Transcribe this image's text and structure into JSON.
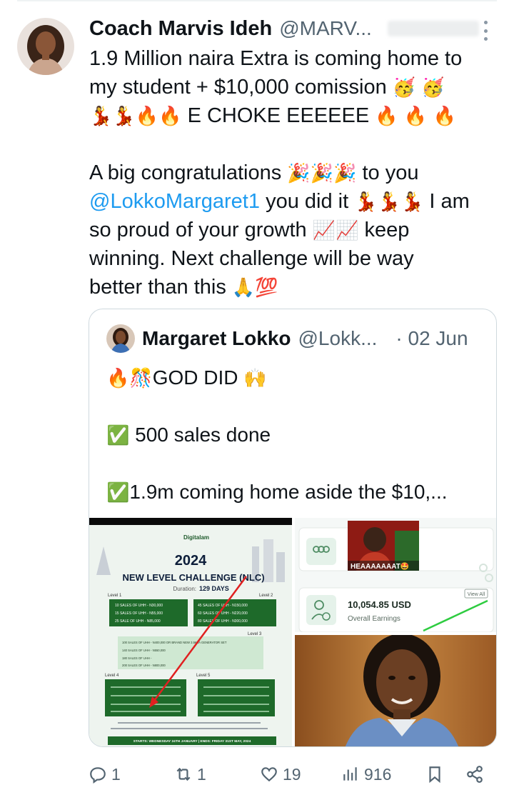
{
  "author": {
    "name": "Coach Marvis Ideh",
    "handle": "@MARV..."
  },
  "tweet": {
    "line1": "1.9 Million naira Extra is coming home to",
    "line2_text": "my student + $10,000 comission",
    "line2_emoji": "🥳 🥳",
    "line3_emoji_pre": "💃💃🔥🔥",
    "line3_text": "E CHOKE EEEEEE",
    "line3_emoji_post": "🔥 🔥 🔥",
    "line5_text": "A big congratulations",
    "line5_emoji": "🎉🎉🎉",
    "line5_text2": "to you",
    "mention": "@LokkoMargaret1",
    "line6_text": "you did it",
    "line6_emoji": "💃💃💃",
    "line6_text2": "I am",
    "line7_text": "so proud of your growth",
    "line7_emoji": "📈📈",
    "line7_text2": "keep",
    "line8": "winning. Next challenge will be way",
    "line9_text": "better than this",
    "line9_emoji": "🙏💯"
  },
  "quote": {
    "name": "Margaret Lokko",
    "handle": "@Lokk...",
    "date": "· 02 Jun",
    "line1_emoji_pre": "🔥🎊",
    "line1_text": "GOD DID",
    "line1_emoji_post": "🙌",
    "line2_emoji": "✅",
    "line2_text": "500 sales done",
    "line3_emoji": "✅",
    "line3_text": "1.9m coming home aside the $10,..."
  },
  "media": {
    "poster": {
      "brand": "Digitalam",
      "year": "2024",
      "title": "NEW LEVEL CHALLENGE (NLC)",
      "duration_label": "Duration:",
      "duration_value": "129 DAYS",
      "level1": "Level 1",
      "level2": "Level 2",
      "level3": "Level 3",
      "level4": "Level 4",
      "level5": "Level 5",
      "l1_rows": [
        "10 SALES OF UHH - N30,000",
        "15 SALES OF UHH - N55,000",
        "25 SALE OF UHH - N85,000"
      ],
      "l2_rows": [
        "45 SALES OF UHH - N150,000",
        "60 SALES OF UHH - N220,000",
        "80 SALES OF UHH - N300,000"
      ],
      "l3_rows": [
        "100 SALES OF UHH - N400,000 OR BRAND NEW 3.5KVA GENERATOR SET",
        "140 SALES OF UHH - N550,000",
        "180 SALES OF UHH -",
        "200 SALES OF UHH - N800,000"
      ],
      "footer": "STARTS: WEDNESDAY 24TH JANUARY | ENDS: FRIDAY 31ST MAY, 2024"
    },
    "earnings": {
      "meme_caption": "HEAAAAAAAT🤩",
      "amount": "10,054.85 USD",
      "label": "Overall Earnings",
      "view_all": "View All"
    }
  },
  "actions": {
    "replies": "1",
    "retweets": "1",
    "likes": "19",
    "views": "916"
  }
}
